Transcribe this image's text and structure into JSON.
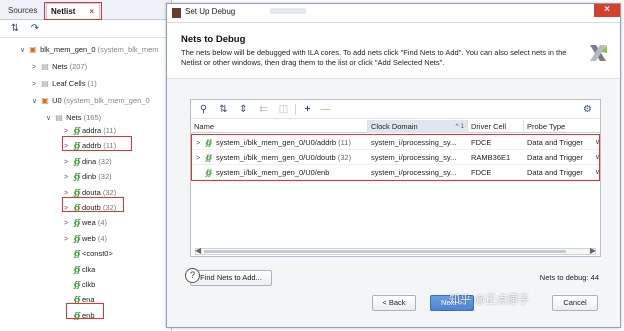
{
  "left_panel": {
    "tabs": {
      "sources": "Sources",
      "netlist": "Netlist",
      "netlist_close": "×"
    },
    "tree": {
      "root_label": "blk_mem_gen_0",
      "root_ctx": "(system_blk_mem",
      "nets_label": "Nets",
      "nets_count": "(207)",
      "leaf_label": "Leaf Cells",
      "leaf_count": "(1)",
      "u0_label": "U0",
      "u0_ctx": "(system_blk_mem_gen_0",
      "u0_nets_label": "Nets",
      "u0_nets_count": "(165)",
      "items": [
        {
          "name": "addra",
          "count": "(11)"
        },
        {
          "name": "addrb",
          "count": "(11)"
        },
        {
          "name": "dina",
          "count": "(32)"
        },
        {
          "name": "dinb",
          "count": "(32)"
        },
        {
          "name": "douta",
          "count": "(32)"
        },
        {
          "name": "doutb",
          "count": "(32)"
        },
        {
          "name": "wea",
          "count": "(4)"
        },
        {
          "name": "web",
          "count": "(4)"
        },
        {
          "name": "<const0>",
          "count": ""
        },
        {
          "name": "clka",
          "count": ""
        },
        {
          "name": "clkb",
          "count": ""
        },
        {
          "name": "ena",
          "count": ""
        },
        {
          "name": "enb",
          "count": ""
        }
      ]
    }
  },
  "dialog": {
    "title": "Set Up Debug",
    "heading": "Nets to Debug",
    "description": "The nets below will be debugged with ILA cores. To add nets click \"Find Nets to Add\". You can also select nets in the Netlist or other windows, then drag them to the list or click \"Add Selected Nets\".",
    "table": {
      "columns": [
        "Name",
        "Clock Domain",
        "Driver Cell",
        "Probe Type"
      ],
      "sort_indicator": "^ 1",
      "rows": [
        {
          "name": "system_i/blk_mem_gen_0/U0/addrb",
          "count": "(11)",
          "clock_domain": "system_i/processing_sy...",
          "driver_cell": "FDCE",
          "probe_type": "Data and Trigger",
          "expandable": true
        },
        {
          "name": "system_i/blk_mem_gen_0/U0/doutb",
          "count": "(32)",
          "clock_domain": "system_i/processing_sy...",
          "driver_cell": "RAMB36E1",
          "probe_type": "Data and Trigger",
          "expandable": true
        },
        {
          "name": "system_i/blk_mem_gen_0/U0/enb",
          "count": "",
          "clock_domain": "system_i/processing_sy...",
          "driver_cell": "FDCE",
          "probe_type": "Data and Trigger",
          "expandable": false
        }
      ]
    },
    "find_nets_button": "Find Nets to Add...",
    "nets_to_debug": "Nets to debug: 44",
    "help": "?",
    "back_button": "< Back",
    "next_button": "Next >",
    "cancel_button": "Cancel",
    "watermark": "知乎 @正点原子"
  }
}
